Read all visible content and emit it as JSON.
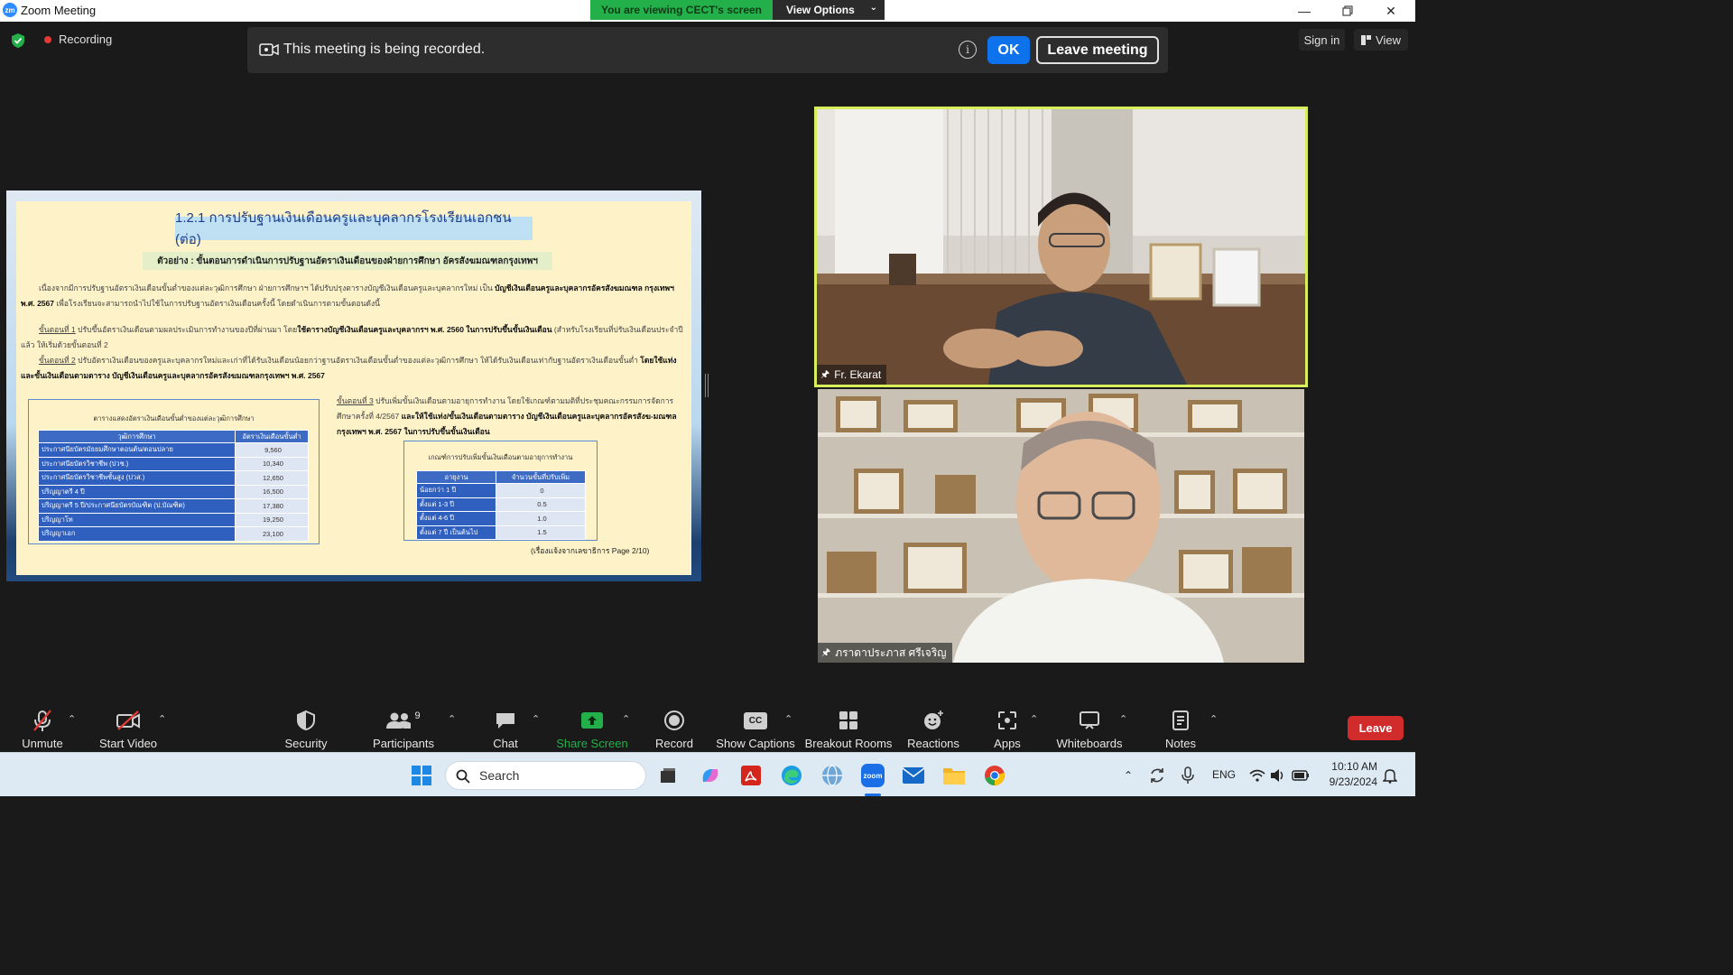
{
  "window": {
    "title": "Zoom Meeting",
    "app_icon_text": "zm",
    "controls": [
      "minimize",
      "restore",
      "close"
    ]
  },
  "share_banner": {
    "viewing_text": "You are viewing CECT's screen",
    "view_options_label": "View Options"
  },
  "meeting_bar": {
    "recording_label": "Recording",
    "sign_in_label": "Sign in",
    "view_label": "View"
  },
  "recording_notice": {
    "message": "This meeting is being recorded.",
    "info_symbol": "i",
    "ok_label": "OK",
    "leave_label": "Leave meeting"
  },
  "slide": {
    "title": "1.2.1  การปรับฐานเงินเดือนครูและบุคลากรโรงเรียนเอกชน (ต่อ)",
    "subtitle": "ตัวอย่าง : ขั้นตอนการดำเนินการปรับฐานอัตราเงินเดือนของฝ่ายการศึกษา อัครสังฆมณฑลกรุงเทพฯ",
    "para1_a": "เนื่องจากมีการปรับฐานอัตราเงินเดือนขั้นต่ำของแต่ละวุฒิการศึกษา ฝ่ายการศึกษาฯ ได้ปรับปรุงตารางบัญชีเงินเดือนครูและบุคลากรใหม่ เป็น ",
    "para1_b": "บัญชีเงินเดือนครูและบุคลากรอัครสังฆมณฑล กรุงเทพฯ พ.ศ. 2567",
    "para1_c": " เพื่อโรงเรียนจะสามารถนำไปใช้ในการปรับฐานอัตราเงินเดือนครั้งนี้ โดยดำเนินการตามขั้นตอนดังนี้",
    "step1_label": "ขั้นตอนที่ 1",
    "step1_a": "  ปรับขึ้นอัตราเงินเดือนตามผลประเมินการทำงานของปีที่ผ่านมา โดย",
    "step1_b": "ใช้ตารางบัญชีเงินเดือนครูและบุคลากรฯ พ.ศ. 2560 ในการปรับขึ้นขั้นเงินเดือน",
    "step1_c": " (สำหรับโรงเรียนที่ปรับเงินเดือนประจำปีแล้ว ให้เริ่มด้วยขั้นตอนที่ 2",
    "step2_label": "ขั้นตอนที่ 2",
    "step2_a": "  ปรับอัตราเงินเดือนของครูและบุคลากรใหม่และเก่าที่ได้รับเงินเดือนน้อยกว่าฐานอัตราเงินเดือนขั้นต่ำของแต่ละวุฒิการศึกษา ให้ได้รับเงินเดือนเท่ากับฐานอัตราเงินเดือนขั้นต่ำ ",
    "step2_b": "โดยใช้แท่งและขั้นเงินเดือนตามตาราง บัญชีเงินเดือนครูและบุคลากรอัครสังฆมณฑลกรุงเทพฯ พ.ศ. 2567",
    "step3_label": "ขั้นตอนที่ 3",
    "step3_a": " ปรับเพิ่มขั้นเงินเดือนตามอายุการทำงาน โดยใช้เกณฑ์ตามมติที่ประชุมคณะกรรมการจัดการศึกษาครั้งที่ 4/2567 ",
    "step3_b": "และให้ใช้แท่ง/ขั้นเงินเดือนตามตาราง บัญชีเงินเดือนครูและบุคลากรอัครสังฆ-มณฑลกรุงเทพฯ พ.ศ. 2567 ในการปรับขึ้นขั้นเงินเดือน",
    "table1": {
      "caption": "ตารางแสดงอัตราเงินเดือนขั้นต่ำของแต่ละวุฒิการศึกษา",
      "headers": [
        "วุฒิการศึกษา",
        "อัตราเงินเดือนขั้นต่ำ"
      ],
      "rows": [
        [
          "ประกาศนียบัตรมัธยมศึกษาตอนต้น/ตอนปลาย",
          "9,560"
        ],
        [
          "ประกาศนียบัตรวิชาชีพ (ปวช.)",
          "10,340"
        ],
        [
          "ประกาศนียบัตรวิชาชีพชั้นสูง (ปวส.)",
          "12,650"
        ],
        [
          "ปริญญาตรี 4 ปี",
          "16,500"
        ],
        [
          "ปริญญาตรี 5 ปี/ประกาศนียบัตรบัณฑิต (ป.บัณฑิต)",
          "17,380"
        ],
        [
          "ปริญญาโท",
          "19,250"
        ],
        [
          "ปริญญาเอก",
          "23,100"
        ]
      ]
    },
    "table2": {
      "caption": "เกณฑ์การปรับเพิ่มขั้นเงินเดือนตามอายุการทำงาน",
      "headers": [
        "อายุงาน",
        "จำนวนขั้นที่ปรับเพิ่ม"
      ],
      "rows": [
        [
          "น้อยกว่า 1 ปี",
          "0"
        ],
        [
          "ตั้งแต่ 1-3 ปี",
          "0.5"
        ],
        [
          "ตั้งแต่ 4-6 ปี",
          "1.0"
        ],
        [
          "ตั้งแต่ 7 ปี เป็นต้นไป",
          "1.5"
        ]
      ]
    },
    "source_note": "(เรื่องแจ้งจากเลขาธิการ Page 2/10)"
  },
  "participants": [
    {
      "name": "Fr. Ekarat",
      "active_speaker": true
    },
    {
      "name": "ภราดาประภาส ศรีเจริญ",
      "active_speaker": false
    }
  ],
  "toolbar": {
    "unmute": "Unmute",
    "start_video": "Start Video",
    "security": "Security",
    "participants": "Participants",
    "participants_count": "9",
    "chat": "Chat",
    "share_screen": "Share Screen",
    "record": "Record",
    "show_captions": "Show Captions",
    "captions_badge": "CC",
    "breakout_rooms": "Breakout Rooms",
    "reactions": "Reactions",
    "apps": "Apps",
    "whiteboards": "Whiteboards",
    "notes": "Notes",
    "leave": "Leave"
  },
  "taskbar": {
    "search_label": "Search",
    "apps": [
      "start-icon",
      "search-icon",
      "task-view-icon",
      "copilot-icon",
      "acrobat-icon",
      "edge-icon",
      "network-globe-icon",
      "zoom-icon",
      "mail-icon",
      "file-explorer-icon",
      "chrome-icon"
    ],
    "zoom_icon_text": "zoom",
    "language": "ENG",
    "time": "10:10 AM",
    "date": "9/23/2024"
  },
  "colors": {
    "zoom_blue": "#0e72ed",
    "share_green": "#23b04a",
    "active_speaker_border": "#d7ef5b",
    "leave_red": "#d22b2b",
    "recording_red": "#e53935"
  }
}
